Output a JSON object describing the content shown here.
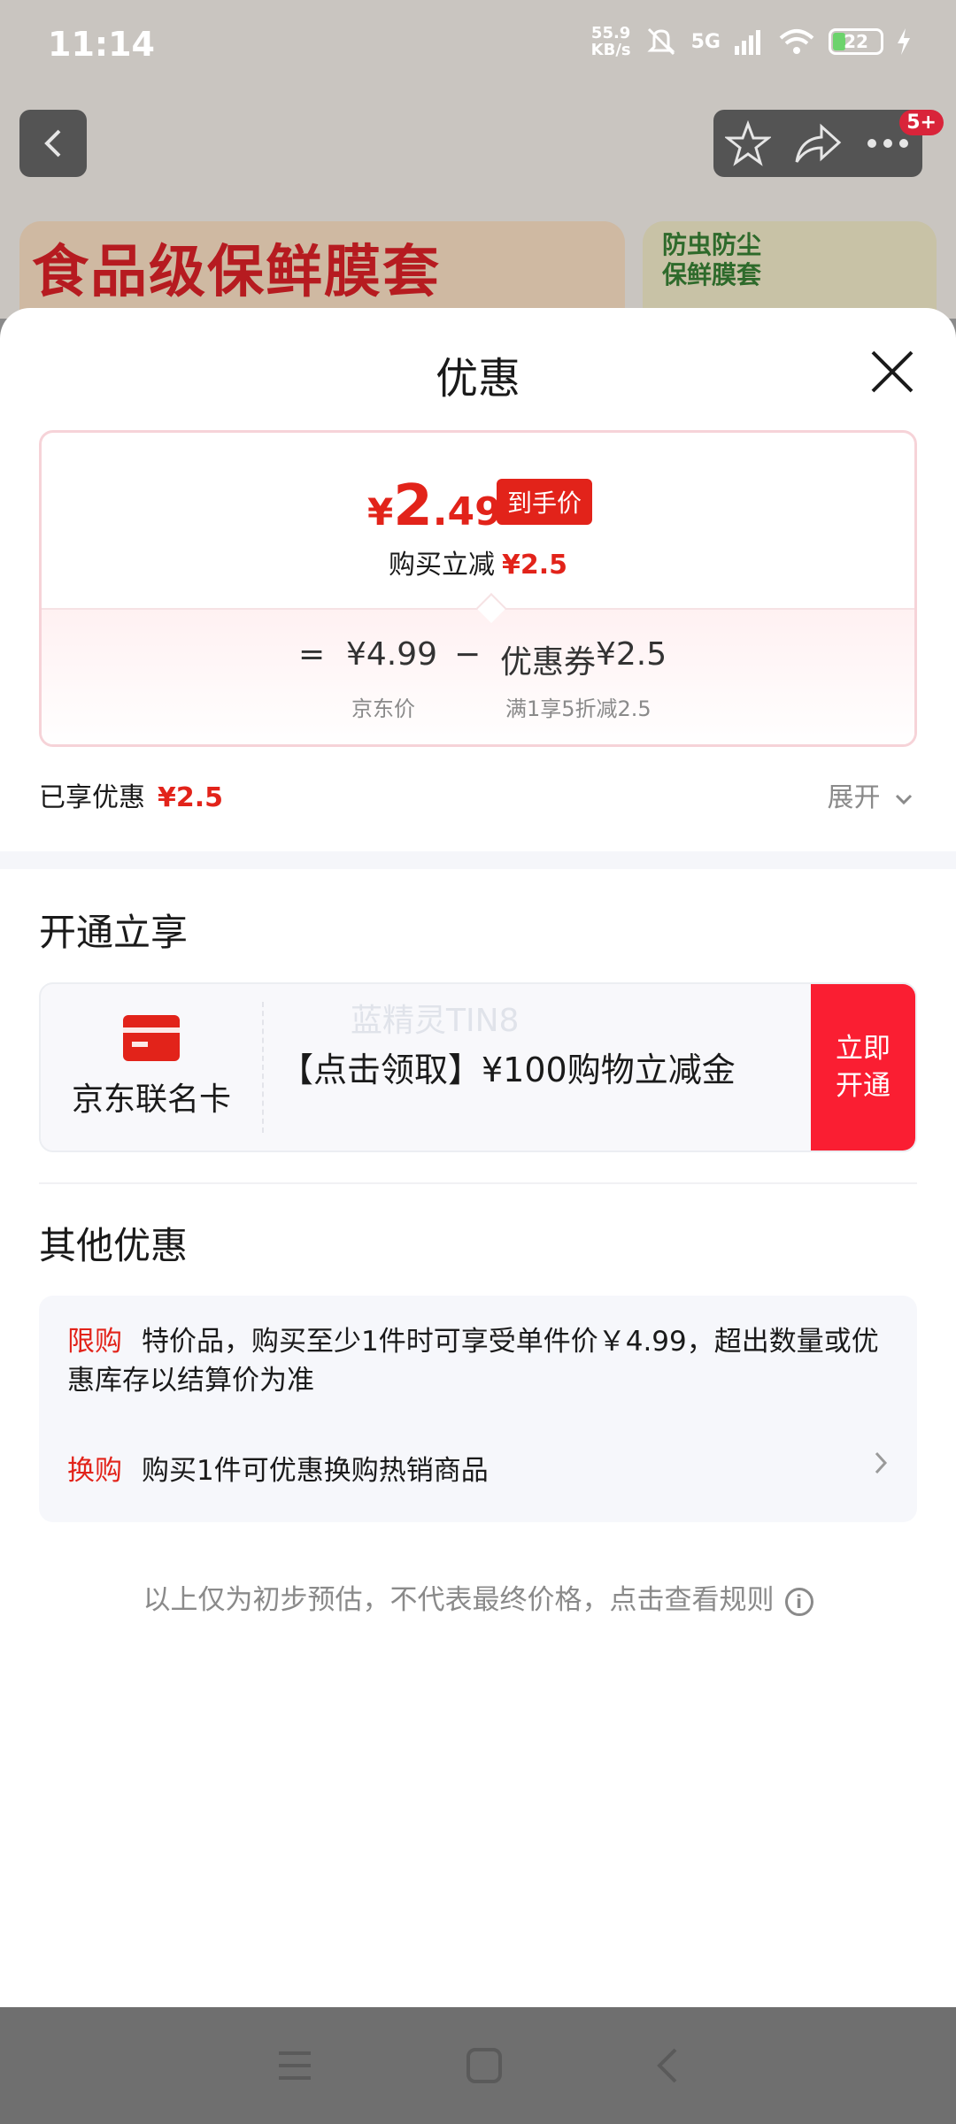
{
  "status": {
    "time": "11:14",
    "speed_top": "55.9",
    "speed_unit": "KB/s",
    "network": "5G",
    "battery": "22"
  },
  "header": {
    "badge": "5+"
  },
  "banners": {
    "left_title": "食品级保鲜膜套",
    "right_line1": "防虫防尘",
    "right_line2": "保鲜膜套"
  },
  "sheet": {
    "title": "优惠",
    "price": {
      "currency": "¥",
      "integer": "2",
      "decimal": ".49",
      "final_tag": "到手价",
      "reduce_label": "购买立减",
      "reduce_amount": "¥2.5"
    },
    "formula": {
      "equals": "=",
      "base_price": "¥4.99",
      "minus": "−",
      "coupon_label": "优惠券",
      "coupon_amount": "¥2.5",
      "base_caption": "京东价",
      "coupon_caption": "满1享5折减2.5"
    },
    "enjoyed_label": "已享优惠",
    "enjoyed_amount": "¥2.5",
    "expand_label": "展开"
  },
  "open_section": {
    "title": "开通立享",
    "card_name": "京东联名卡",
    "watermark": "蓝精灵TIN8",
    "offer_text": "【点击领取】¥100购物立减金",
    "cta": "立即开通"
  },
  "other_section": {
    "title": "其他优惠",
    "limit_tag": "限购",
    "limit_text": "特价品，购买至少1件时可享受单件价￥4.99，超出数量或优惠库存以结算价为准",
    "swap_tag": "换购",
    "swap_text": "购买1件可优惠换购热销商品"
  },
  "disclaimer": "以上仅为初步预估，不代表最终价格，点击查看规则",
  "colors": {
    "accent": "#e2231a",
    "cta": "#fa1e32"
  }
}
